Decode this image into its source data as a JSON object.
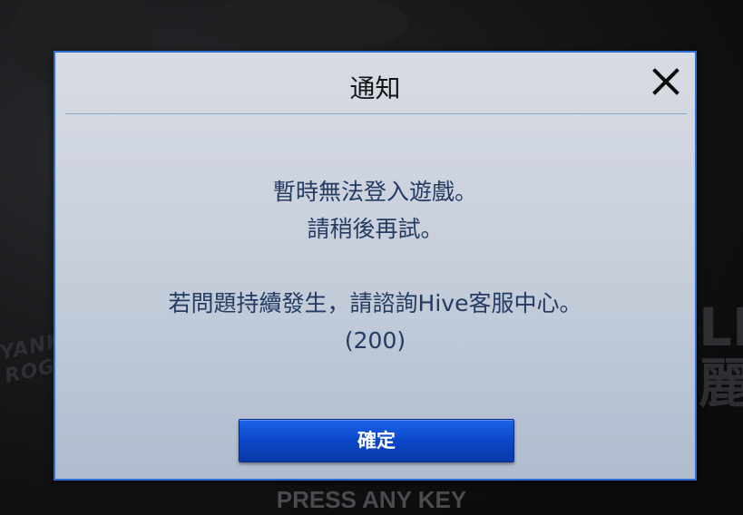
{
  "background": {
    "art_text_left": "YANK\nROGHE",
    "art_text_right": "LE\n麗",
    "press_any_key": "PRESS ANY KEY"
  },
  "dialog": {
    "title": "通知",
    "close_icon": "close-icon",
    "message_lines": [
      "暫時無法登入遊戲。",
      "請稍後再試。",
      "",
      "若問題持續發生，請諮詢Hive客服中心。",
      "(200)"
    ],
    "confirm_label": "確定"
  },
  "colors": {
    "dialog_border": "#2f6ed6",
    "message_text": "#243b62",
    "button_blue": "#0c47c9"
  }
}
